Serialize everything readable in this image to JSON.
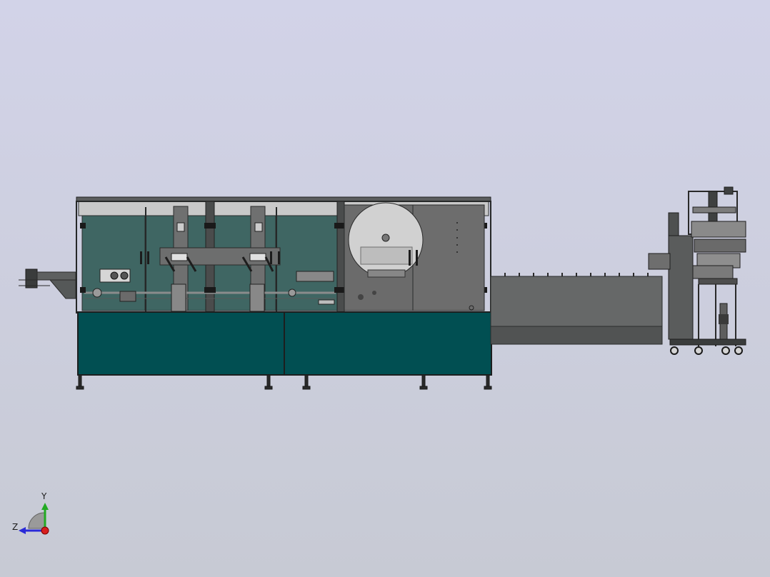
{
  "viewport": {
    "background_top": "#d2d3e8",
    "background_bottom": "#c7cad4"
  },
  "triad": {
    "y_label": "Y",
    "z_label": "Z",
    "y_color": "#22aa22",
    "z_color": "#2a2ad8",
    "x_color": "#d81e1e"
  },
  "colors": {
    "teal": "#014f52",
    "glass": "#3f6663",
    "frame": "#303232",
    "steel_dark": "#4d4d4d",
    "steel_mid": "#6b6b6b",
    "steel_light": "#8a8a8a",
    "roof": "#c9c9c9"
  }
}
